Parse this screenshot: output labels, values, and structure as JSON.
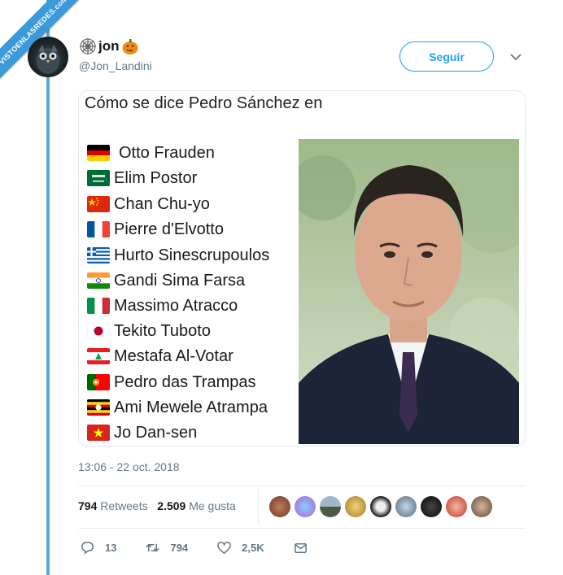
{
  "watermark": "VISTOENLASREDES.com",
  "user": {
    "name": "jon",
    "handle": "@Jon_Landini",
    "icons": [
      "spider-web-icon",
      "pumpkin-icon"
    ]
  },
  "follow_label": "Seguir",
  "card": {
    "title": "Cómo se dice Pedro Sánchez en",
    "items": [
      {
        "flag": "germany-flag-icon",
        "text": "Otto Frauden"
      },
      {
        "flag": "saudi-arabia-flag-icon",
        "text": "Elim Postor"
      },
      {
        "flag": "china-flag-icon",
        "text": "Chan Chu-yo"
      },
      {
        "flag": "france-flag-icon",
        "text": "Pierre d'Elvotto"
      },
      {
        "flag": "greece-flag-icon",
        "text": "Hurto Sinescrupoulos"
      },
      {
        "flag": "india-flag-icon",
        "text": "Gandi Sima Farsa"
      },
      {
        "flag": "italy-flag-icon",
        "text": "Massimo Atracco"
      },
      {
        "flag": "japan-flag-icon",
        "text": "Tekito Tuboto"
      },
      {
        "flag": "lebanon-flag-icon",
        "text": "Mestafa Al-Votar"
      },
      {
        "flag": "portugal-flag-icon",
        "text": "Pedro das Trampas"
      },
      {
        "flag": "uganda-flag-icon",
        "text": "Ami Mewele Atrampa"
      },
      {
        "flag": "vietnam-flag-icon",
        "text": "Jo Dan-sen"
      }
    ]
  },
  "timestamp": "13:06 - 22 oct. 2018",
  "stats": {
    "retweets_count": "794",
    "retweets_label": "Retweets",
    "likes_count": "2.509",
    "likes_label": "Me gusta"
  },
  "actions": {
    "reply": "13",
    "retweet": "794",
    "like": "2,5K"
  },
  "colors": {
    "accent": "#1da1f2",
    "watermark": "#3b9ad9"
  }
}
